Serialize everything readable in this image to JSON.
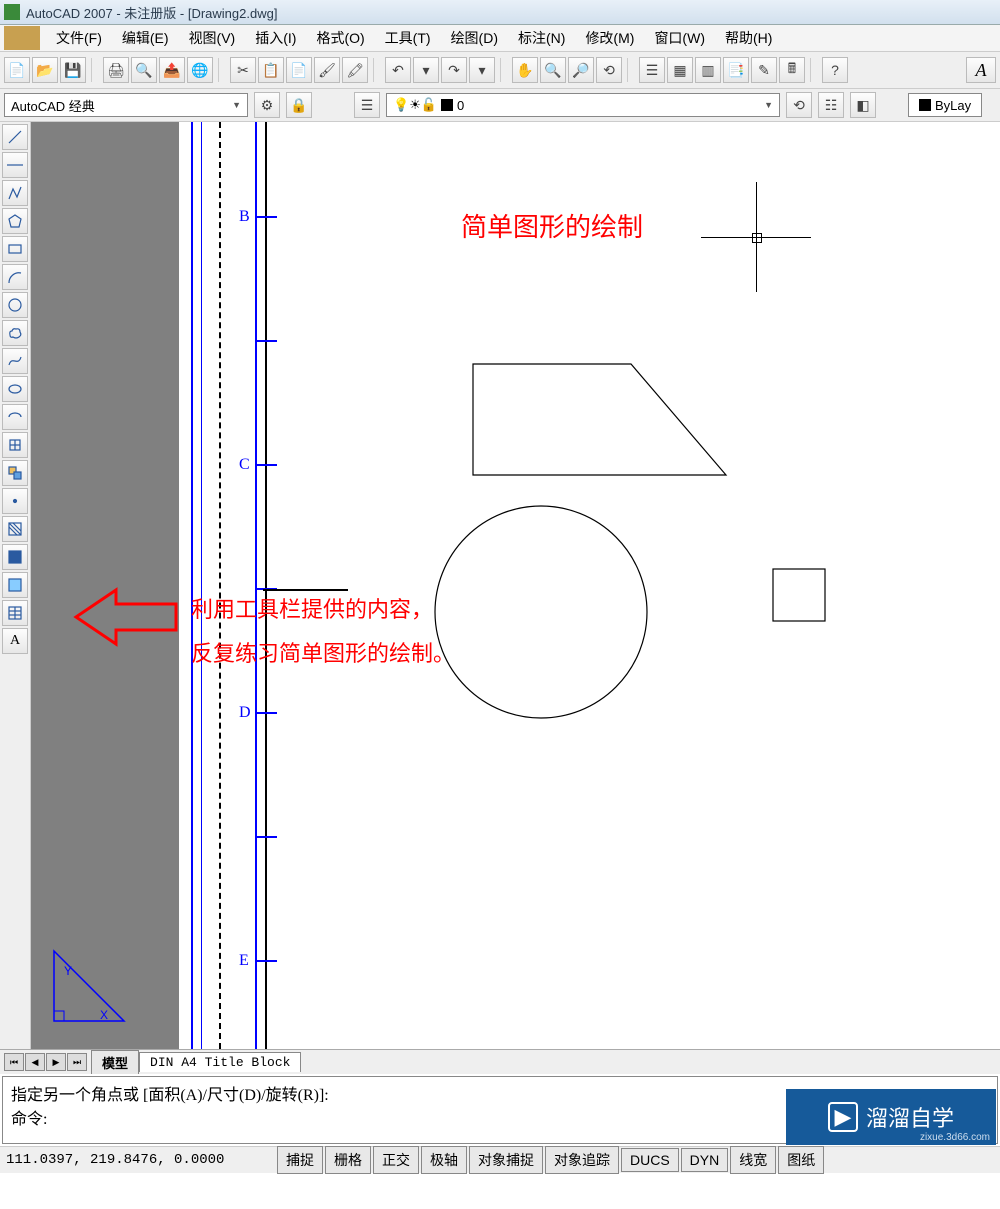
{
  "title": "AutoCAD 2007 - 未注册版 - [Drawing2.dwg]",
  "menu": {
    "file": "文件(F)",
    "edit": "编辑(E)",
    "view": "视图(V)",
    "insert": "插入(I)",
    "format": "格式(O)",
    "tools": "工具(T)",
    "draw": "绘图(D)",
    "dimension": "标注(N)",
    "modify": "修改(M)",
    "window": "窗口(W)",
    "help": "帮助(H)"
  },
  "workspace": "AutoCAD 经典",
  "layer": {
    "name": "0",
    "bulb": "💡",
    "sun": "☀",
    "lock": "🔓"
  },
  "bylayer": "ByLay",
  "ruler": {
    "b": "B",
    "c": "C",
    "d": "D",
    "e": "E"
  },
  "annot": {
    "title": "简单图形的绘制",
    "line1": "利用工具栏提供的内容，",
    "line2": "反复练习简单图形的绘制。"
  },
  "tabs": {
    "model": "模型",
    "layout": "DIN A4 Title Block"
  },
  "cmd": {
    "prompt": "指定另一个角点或 [面积(A)/尺寸(D)/旋转(R)]:",
    "label": "命令:"
  },
  "status": {
    "coords": "111.0397, 219.8476, 0.0000",
    "snap": "捕捉",
    "grid": "栅格",
    "ortho": "正交",
    "polar": "极轴",
    "osnap": "对象捕捉",
    "otrack": "对象追踪",
    "ducs": "DUCS",
    "dyn": "DYN",
    "lwt": "线宽",
    "paper": "图纸"
  },
  "watermark": {
    "text": "溜溜自学",
    "url": "zixue.3d66.com"
  }
}
